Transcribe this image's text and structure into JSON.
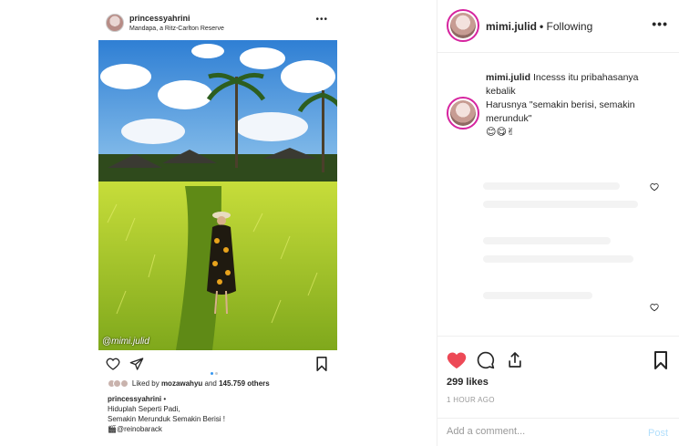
{
  "left_post": {
    "username": "princessyahrini",
    "location": "Mandapa, a Ritz-Carlton Reserve",
    "more_label": "•••",
    "watermark": "@mimi.julid",
    "likes": {
      "prefix": "Liked by",
      "user": "mozawahyu",
      "conjunction": "and",
      "count": "145.759 others"
    },
    "caption": {
      "author": "princessyahrini",
      "author_suffix": " •",
      "line1": "Hiduplah Seperti Padi,",
      "line2": "Semakin Merunduk Semakin Berisi !",
      "line3_icon": "🎬",
      "line3": "@reinobarack"
    },
    "carousel": {
      "count": 2,
      "active": 0
    }
  },
  "right_panel": {
    "header": {
      "username": "mimi.julid",
      "separator": "•",
      "follow_status": "Following",
      "more_label": "•••"
    },
    "comment": {
      "author": "mimi.julid",
      "line1": "Incesss itu pribahasanya kebalik",
      "line2": "Harusnya \"semakin berisi, semakin merunduk\"",
      "emojis": "😊😋✌"
    },
    "likes": "299 likes",
    "time": "1 HOUR AGO",
    "add_comment_placeholder": "Add a comment...",
    "post_label": "Post"
  },
  "colors": {
    "like_red": "#ed4956",
    "link_blue": "#3897f0",
    "post_disabled": "#b2dffc",
    "story_ring": "#d6249f"
  }
}
